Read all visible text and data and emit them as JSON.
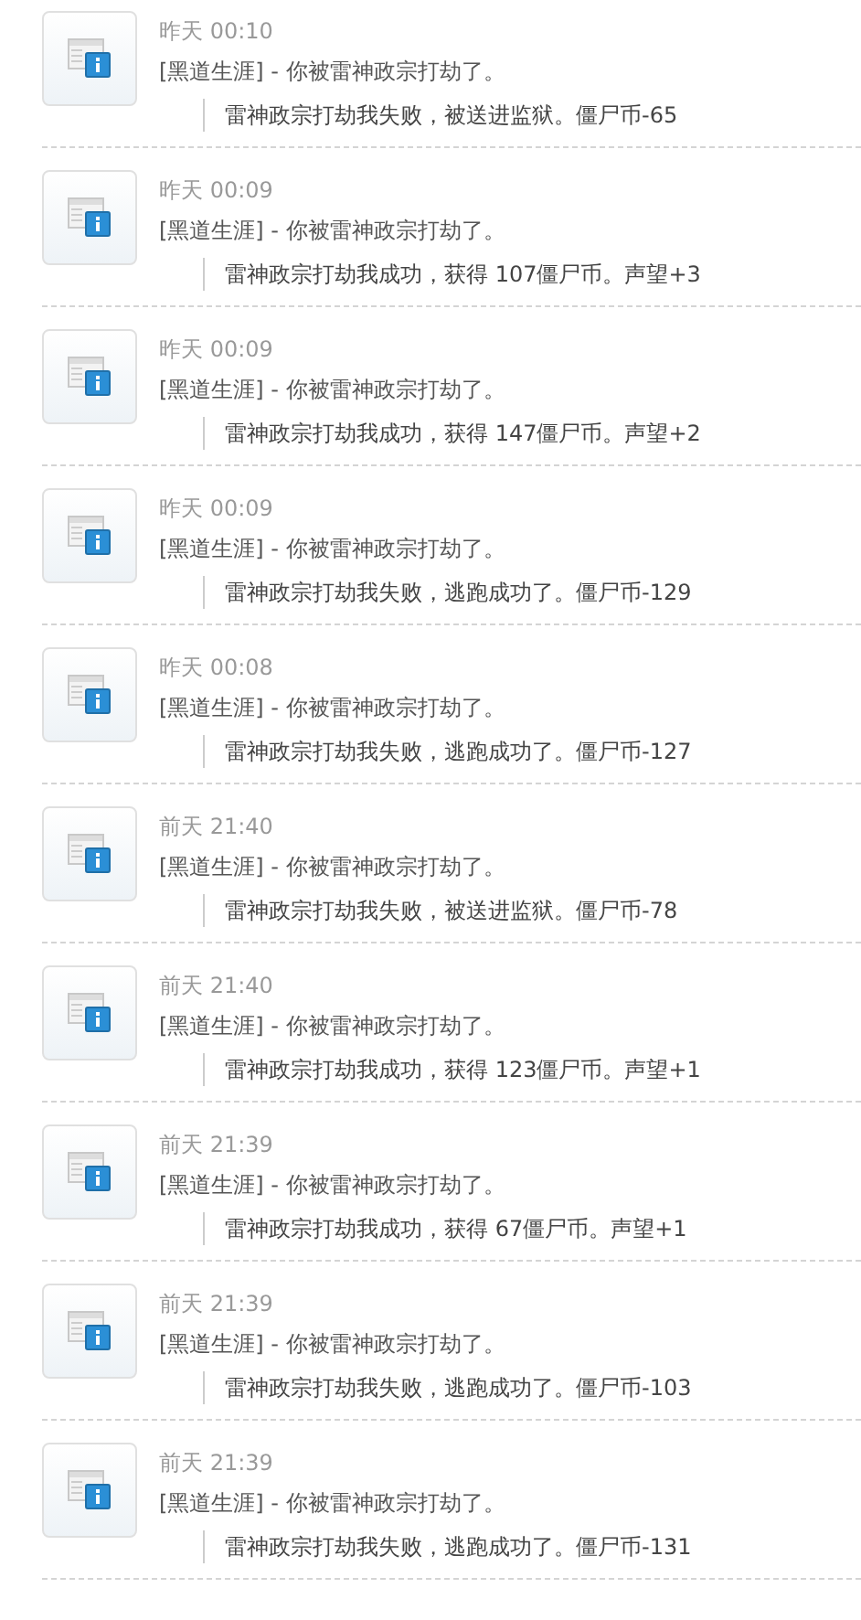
{
  "entries": [
    {
      "time": "昨天 00:10",
      "message": "[黑道生涯] - 你被雷神政宗打劫了。",
      "detail": "雷神政宗打劫我失败，被送进监狱。僵尸币-65"
    },
    {
      "time": "昨天 00:09",
      "message": "[黑道生涯] - 你被雷神政宗打劫了。",
      "detail": "雷神政宗打劫我成功，获得 107僵尸币。声望+3"
    },
    {
      "time": "昨天 00:09",
      "message": "[黑道生涯] - 你被雷神政宗打劫了。",
      "detail": "雷神政宗打劫我成功，获得 147僵尸币。声望+2"
    },
    {
      "time": "昨天 00:09",
      "message": "[黑道生涯] - 你被雷神政宗打劫了。",
      "detail": "雷神政宗打劫我失败，逃跑成功了。僵尸币-129"
    },
    {
      "time": "昨天 00:08",
      "message": "[黑道生涯] - 你被雷神政宗打劫了。",
      "detail": "雷神政宗打劫我失败，逃跑成功了。僵尸币-127"
    },
    {
      "time": "前天 21:40",
      "message": "[黑道生涯] - 你被雷神政宗打劫了。",
      "detail": "雷神政宗打劫我失败，被送进监狱。僵尸币-78"
    },
    {
      "time": "前天 21:40",
      "message": "[黑道生涯] - 你被雷神政宗打劫了。",
      "detail": "雷神政宗打劫我成功，获得 123僵尸币。声望+1"
    },
    {
      "time": "前天 21:39",
      "message": "[黑道生涯] - 你被雷神政宗打劫了。",
      "detail": "雷神政宗打劫我成功，获得 67僵尸币。声望+1"
    },
    {
      "time": "前天 21:39",
      "message": "[黑道生涯] - 你被雷神政宗打劫了。",
      "detail": "雷神政宗打劫我失败，逃跑成功了。僵尸币-103"
    },
    {
      "time": "前天 21:39",
      "message": "[黑道生涯] - 你被雷神政宗打劫了。",
      "detail": "雷神政宗打劫我失败，逃跑成功了。僵尸币-131"
    }
  ]
}
